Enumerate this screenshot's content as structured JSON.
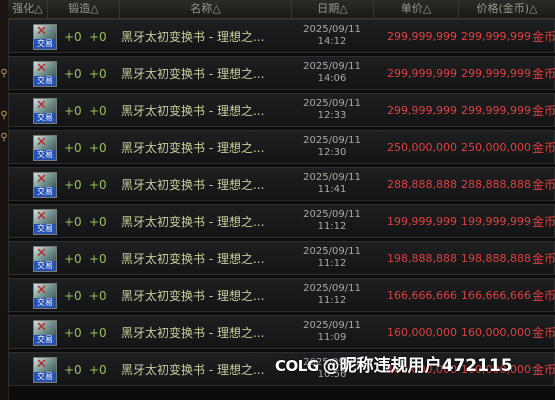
{
  "header": {
    "columns": [
      "强化△",
      "锻造△",
      "名称△",
      "日期△",
      "单价△",
      "价格(金币)△"
    ]
  },
  "rows": [
    {
      "icon_tag": "交易",
      "enhance": "+0",
      "refine": "+0",
      "name": "黑牙太初变换书 - 理想之...",
      "date": "2025/09/11",
      "time": "14:12",
      "unit_price": "299,999,999",
      "total_price": "299,999,999",
      "currency": "金币"
    },
    {
      "icon_tag": "交易",
      "enhance": "+0",
      "refine": "+0",
      "name": "黑牙太初变换书 - 理想之...",
      "date": "2025/09/11",
      "time": "14:06",
      "unit_price": "299,999,999",
      "total_price": "299,999,999",
      "currency": "金币"
    },
    {
      "icon_tag": "交易",
      "enhance": "+0",
      "refine": "+0",
      "name": "黑牙太初变换书 - 理想之...",
      "date": "2025/09/11",
      "time": "12:33",
      "unit_price": "299,999,999",
      "total_price": "299,999,999",
      "currency": "金币"
    },
    {
      "icon_tag": "交易",
      "enhance": "+0",
      "refine": "+0",
      "name": "黑牙太初变换书 - 理想之...",
      "date": "2025/09/11",
      "time": "12:30",
      "unit_price": "250,000,000",
      "total_price": "250,000,000",
      "currency": "金币"
    },
    {
      "icon_tag": "交易",
      "enhance": "+0",
      "refine": "+0",
      "name": "黑牙太初变换书 - 理想之...",
      "date": "2025/09/11",
      "time": "11:41",
      "unit_price": "288,888,888",
      "total_price": "288,888,888",
      "currency": "金币"
    },
    {
      "icon_tag": "交易",
      "enhance": "+0",
      "refine": "+0",
      "name": "黑牙太初变换书 - 理想之...",
      "date": "2025/09/11",
      "time": "11:12",
      "unit_price": "199,999,999",
      "total_price": "199,999,999",
      "currency": "金币"
    },
    {
      "icon_tag": "交易",
      "enhance": "+0",
      "refine": "+0",
      "name": "黑牙太初变换书 - 理想之...",
      "date": "2025/09/11",
      "time": "11:12",
      "unit_price": "198,888,888",
      "total_price": "198,888,888",
      "currency": "金币"
    },
    {
      "icon_tag": "交易",
      "enhance": "+0",
      "refine": "+0",
      "name": "黑牙太初变换书 - 理想之...",
      "date": "2025/09/11",
      "time": "11:12",
      "unit_price": "166,666,666",
      "total_price": "166,666,666",
      "currency": "金币"
    },
    {
      "icon_tag": "交易",
      "enhance": "+0",
      "refine": "+0",
      "name": "黑牙太初变换书 - 理想之...",
      "date": "2025/09/11",
      "time": "11:09",
      "unit_price": "160,000,000",
      "total_price": "160,000,000",
      "currency": "金币"
    },
    {
      "icon_tag": "交易",
      "enhance": "+0",
      "refine": "+0",
      "name": "黑牙太初变换书 - 理想之...",
      "date": "2025/09/11",
      "time": "10:56",
      "unit_price": "160,000,000",
      "total_price": "160,000,000",
      "currency": "金币"
    }
  ],
  "watermark": {
    "logo": "COLG",
    "text": "@昵称违规用户472115"
  },
  "colors": {
    "price_red": "#e04040",
    "stat_green": "#9dbf5a",
    "name_yellow": "#c8ce9a"
  },
  "icons": {
    "row_item": "transform-book-icon",
    "side": "search-icon"
  }
}
